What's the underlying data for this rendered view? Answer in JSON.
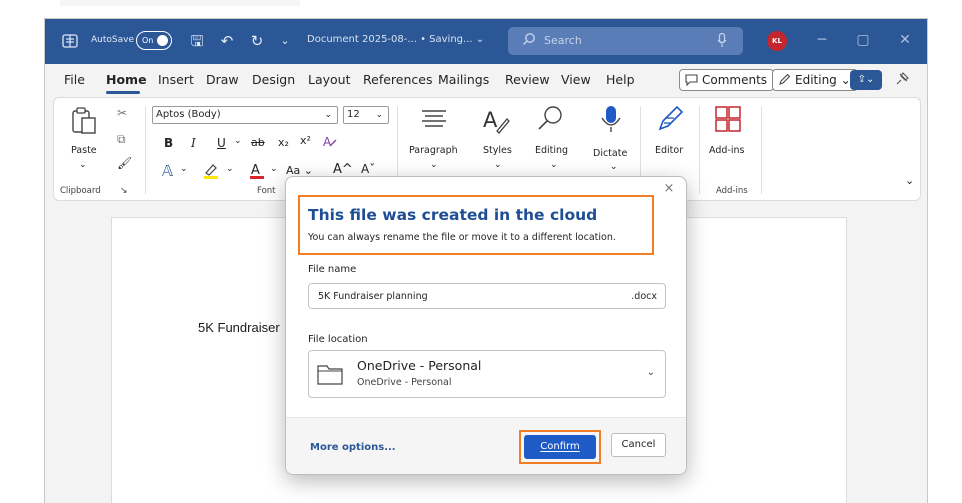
{
  "titlebar": {
    "autosave_label": "AutoSave",
    "autosave_state": "On",
    "document_title": "Document 2025-08-... • Saving... ⌄",
    "search_placeholder": "Search",
    "avatar_initials": "KL",
    "minimize": "─",
    "maximize": "▢",
    "close": "✕"
  },
  "menu": {
    "tabs": [
      "File",
      "Home",
      "Insert",
      "Draw",
      "Design",
      "Layout",
      "References",
      "Mailings",
      "Review",
      "View",
      "Help"
    ],
    "active_tab": "Home",
    "comments_label": "Comments",
    "editing_label": "Editing ⌄",
    "share_label": "⇪⌄"
  },
  "ribbon": {
    "paste_label": "Paste",
    "clipboard_label": "Clipboard",
    "font_name": "Aptos (Body)",
    "font_size": "12",
    "font_label": "Font",
    "paragraph_label": "Paragraph",
    "styles_label": "Styles",
    "editing_label": "Editing",
    "dictate_label": "Dictate",
    "editor_label": "Editor",
    "addins_label": "Add-ins",
    "addins_group_label": "Add-ins",
    "format_bold": "B",
    "format_italic": "I",
    "format_underline": "U",
    "format_strike": "ab",
    "format_sub": "x₂",
    "format_sup": "x²",
    "format_case": "Aa ⌄",
    "font_grow": "A^",
    "font_shrink": "Aˇ"
  },
  "document": {
    "body_text": "5K Fundraiser"
  },
  "dialog": {
    "title": "This file was created in the cloud",
    "subtitle": "You can always rename the file or move it to a different location.",
    "file_name_label": "File name",
    "file_name_value": "5K Fundraiser planning",
    "file_extension": ".docx",
    "file_location_label": "File location",
    "location_name": "OneDrive - Personal",
    "location_sub": "OneDrive - Personal",
    "more_options": "More options...",
    "confirm": "Confirm",
    "cancel": "Cancel",
    "close": "×"
  },
  "colors": {
    "titlebar": "#2b5797",
    "accent": "#1e5bc6",
    "highlight": "#f07e26",
    "avatar": "#c4262e"
  }
}
